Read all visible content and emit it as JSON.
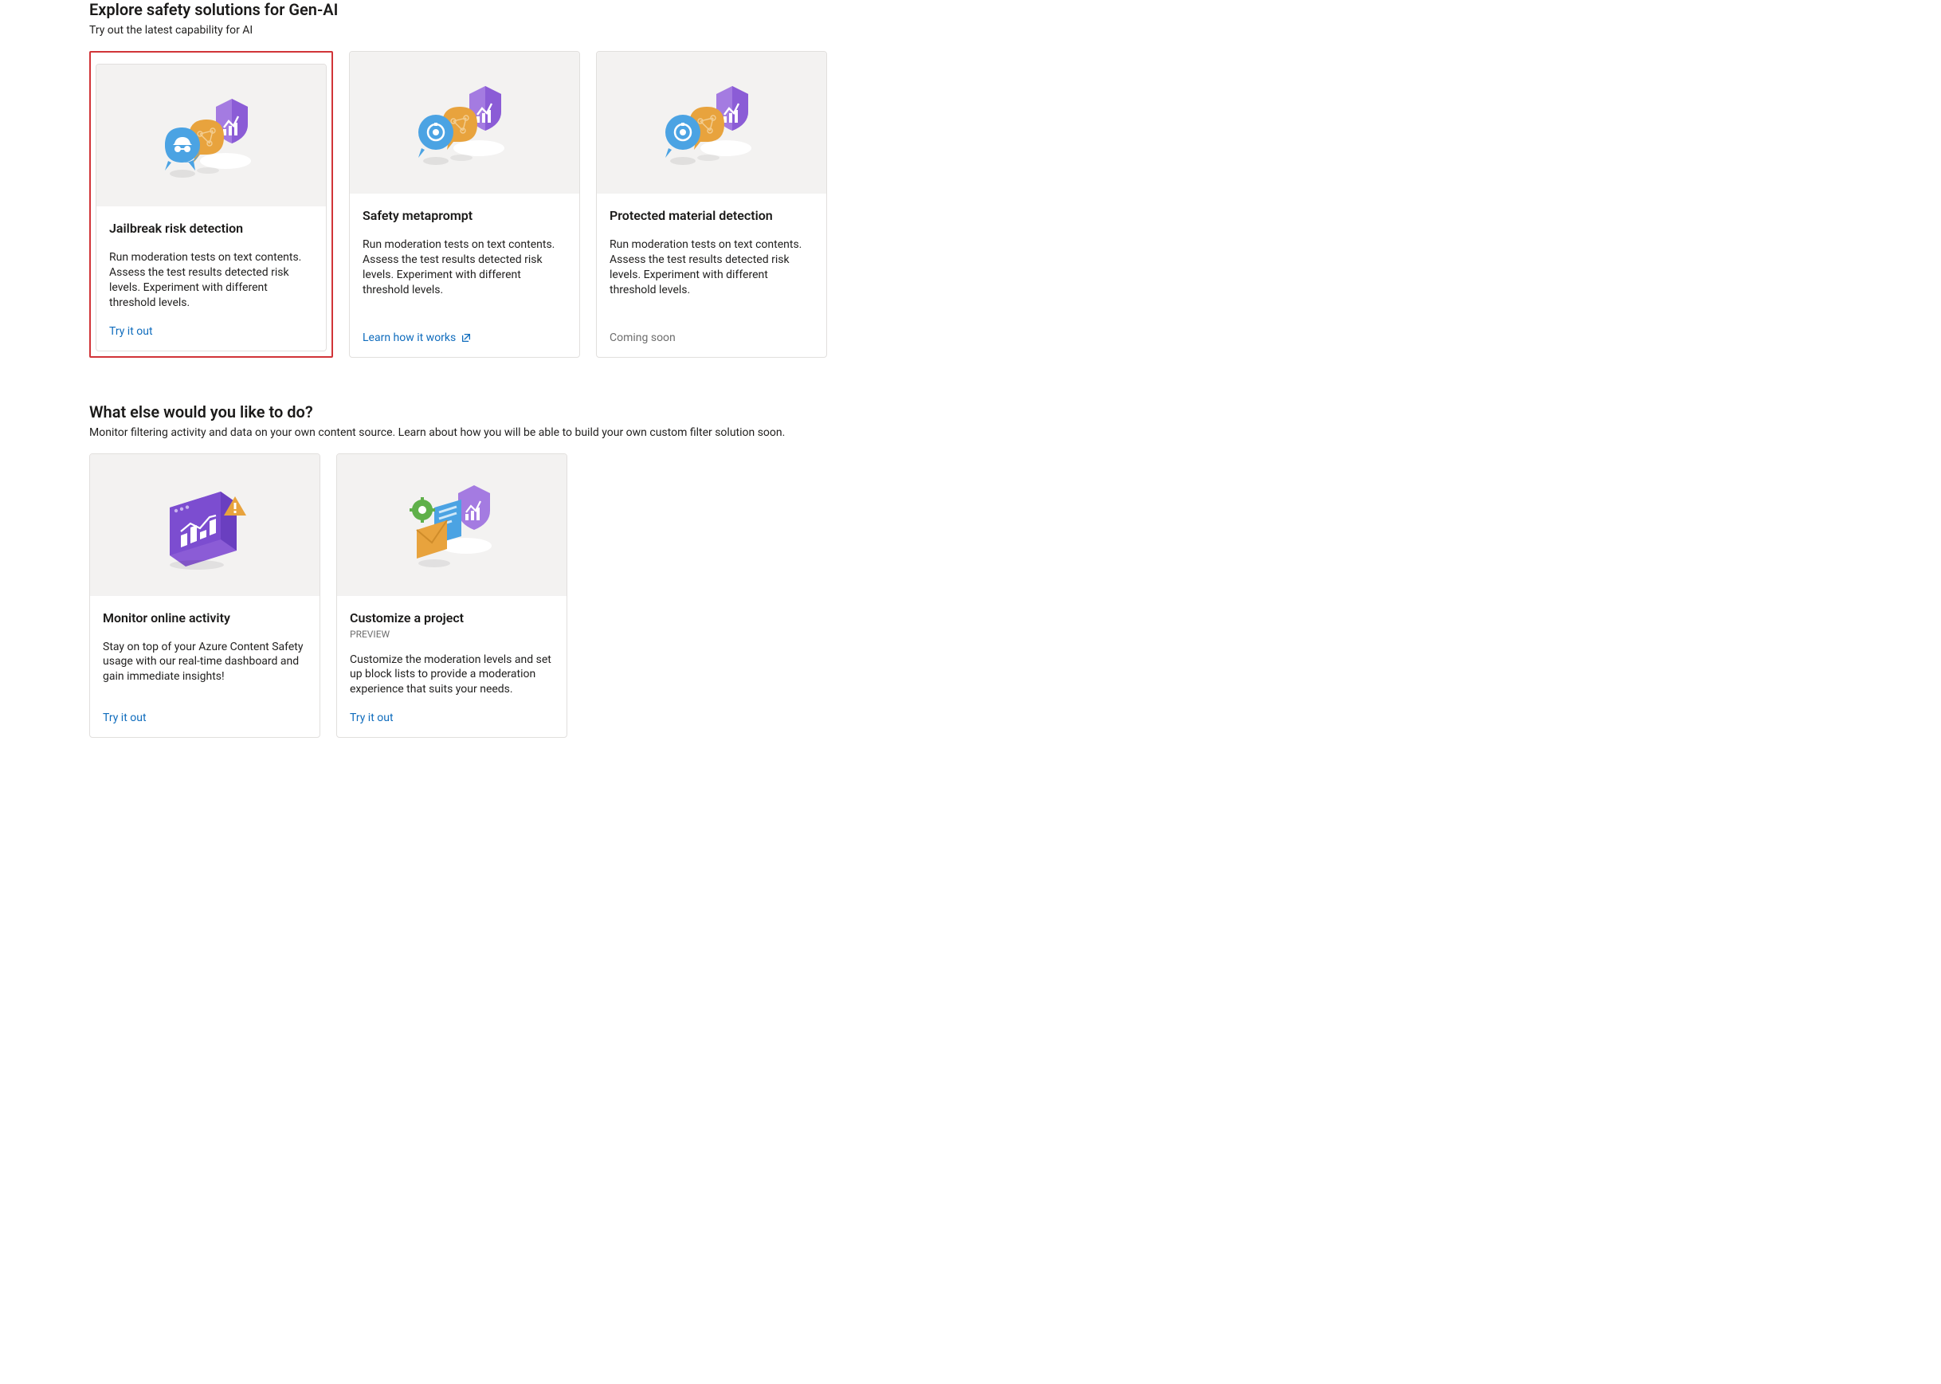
{
  "section1": {
    "heading": "Explore safety solutions for Gen-AI",
    "sub": "Try out the latest capability for AI",
    "cards": [
      {
        "title": "Jailbreak risk detection",
        "desc": "Run moderation tests on text contents. Assess the test results detected risk levels. Experiment with different threshold levels.",
        "cta": "Try it out"
      },
      {
        "title": "Safety metaprompt",
        "desc": "Run moderation tests on text contents. Assess the test results detected risk levels. Experiment with different threshold levels.",
        "cta": "Learn how it works"
      },
      {
        "title": "Protected material detection",
        "desc": "Run moderation tests on text contents. Assess the test results detected risk levels. Experiment with different threshold levels.",
        "cta": "Coming soon"
      }
    ]
  },
  "section2": {
    "heading": "What else would you like to do?",
    "sub": "Monitor filtering activity and data on your own content source. Learn about how you will be able to build your own custom filter solution soon.",
    "cards": [
      {
        "title": "Monitor online activity",
        "sublabel": "",
        "desc": "Stay on top of your Azure Content Safety usage with our real-time dashboard and gain immediate insights!",
        "cta": "Try it out"
      },
      {
        "title": "Customize a project",
        "sublabel": "PREVIEW",
        "desc": "Customize the moderation levels and set up block lists to provide a moderation experience that suits your needs.",
        "cta": "Try it out"
      }
    ]
  },
  "colors": {
    "link": "#0f6cbd",
    "highlight": "#d13438",
    "muted": "#6e6e6e"
  }
}
